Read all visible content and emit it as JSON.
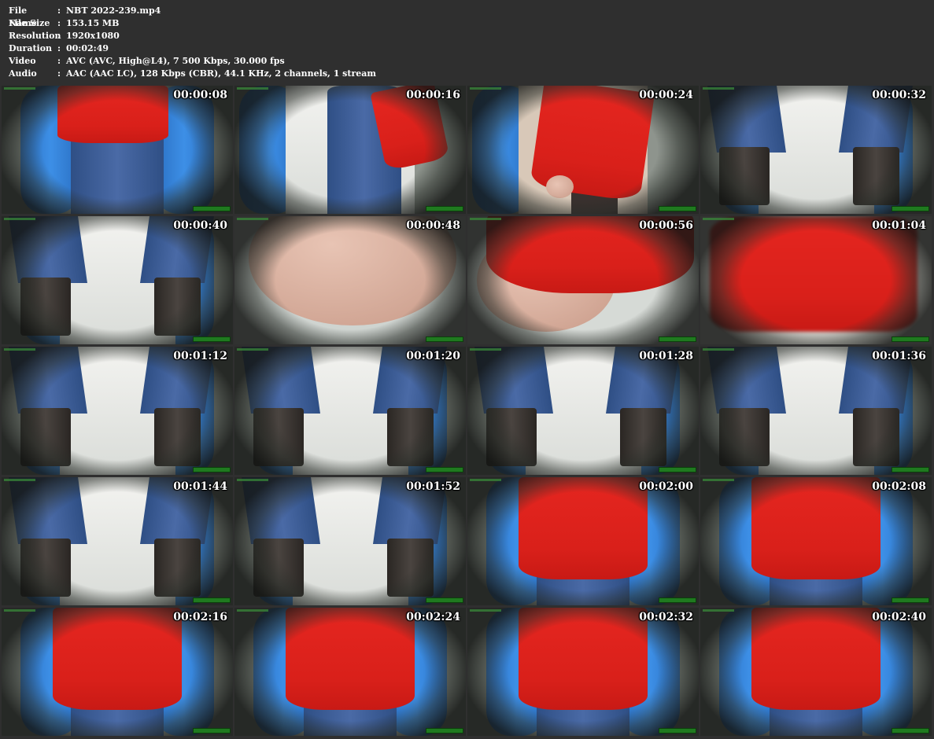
{
  "info": [
    {
      "key": "File Name",
      "sep": ":",
      "value": "NBT 2022-239.mp4"
    },
    {
      "key": "File Size",
      "sep": ":",
      "value": "153.15 MB"
    },
    {
      "key": "Resolution",
      "sep": ":",
      "value": "1920x1080"
    },
    {
      "key": "Duration",
      "sep": ":",
      "value": "00:02:49"
    },
    {
      "key": "Video",
      "sep": ":",
      "value": "AVC (AVC, High@L4), 7 500 Kbps, 30.000 fps"
    },
    {
      "key": "Audio",
      "sep": ":",
      "value": "AAC (AAC LC), 128 Kbps (CBR), 44.1 KHz, 2 channels, 1 stream"
    }
  ],
  "thumbnails": [
    {
      "time": "00:00:08",
      "scene": "coat-jeans"
    },
    {
      "time": "00:00:16",
      "scene": "jeans-side"
    },
    {
      "time": "00:00:24",
      "scene": "coat-side"
    },
    {
      "time": "00:00:32",
      "scene": "legs-boots"
    },
    {
      "time": "00:00:40",
      "scene": "legs-boots"
    },
    {
      "time": "00:00:48",
      "scene": "closeup-skin"
    },
    {
      "time": "00:00:56",
      "scene": "closeup-red"
    },
    {
      "time": "00:01:04",
      "scene": "blur-red"
    },
    {
      "time": "00:01:12",
      "scene": "legs-boots"
    },
    {
      "time": "00:01:20",
      "scene": "legs-boots"
    },
    {
      "time": "00:01:28",
      "scene": "legs-boots"
    },
    {
      "time": "00:01:36",
      "scene": "legs-boots"
    },
    {
      "time": "00:01:44",
      "scene": "legs-boots"
    },
    {
      "time": "00:01:52",
      "scene": "legs-boots"
    },
    {
      "time": "00:02:00",
      "scene": "red-coat"
    },
    {
      "time": "00:02:08",
      "scene": "red-coat"
    },
    {
      "time": "00:02:16",
      "scene": "red-coat"
    },
    {
      "time": "00:02:24",
      "scene": "red-coat"
    },
    {
      "time": "00:02:32",
      "scene": "red-coat"
    },
    {
      "time": "00:02:40",
      "scene": "red-coat"
    }
  ],
  "colors": {
    "background": "#2f2f2f",
    "text": "#ffffff",
    "coat_red": "#e52620",
    "stall_blue": "#3d8fe6",
    "jeans_blue": "#4a6aa6"
  }
}
